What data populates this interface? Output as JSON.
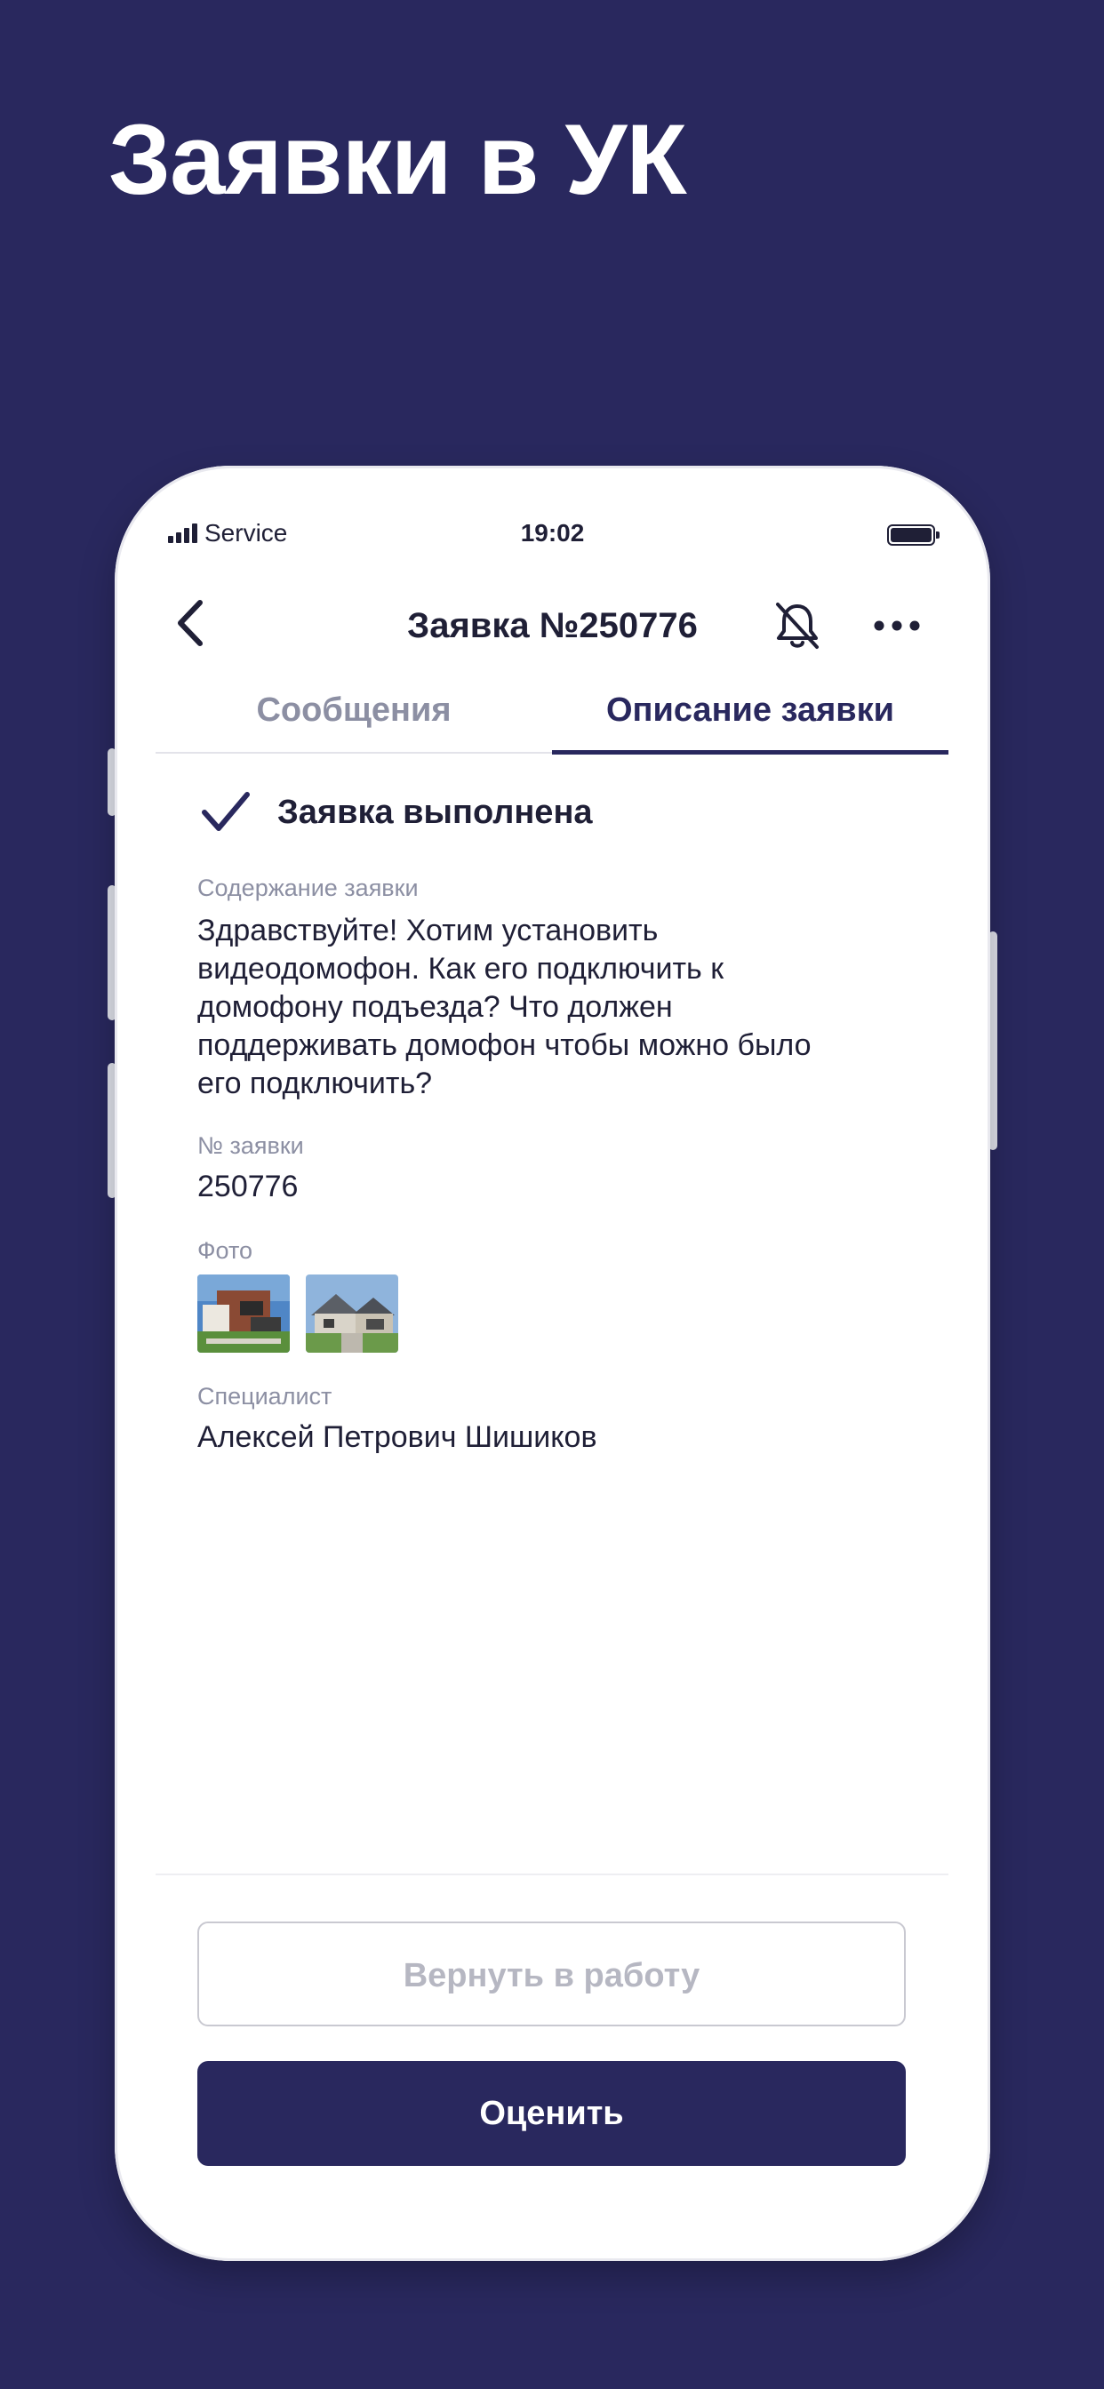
{
  "promo": {
    "headline": "Заявки в УК"
  },
  "status_bar": {
    "carrier": "Service",
    "time": "19:02"
  },
  "nav": {
    "title": "Заявка №250776",
    "back_icon": "chevron-left-icon",
    "bell_icon": "bell-off-icon",
    "more_icon": "more-horizontal-icon"
  },
  "tabs": [
    {
      "label": "Сообщения",
      "active": false
    },
    {
      "label": "Описание заявки",
      "active": true
    }
  ],
  "request": {
    "status_icon": "checkmark-icon",
    "status_text": "Заявка выполнена",
    "content_label": "Содержание заявки",
    "content_lines": [
      "Здравствуйте! Хотим установить",
      "видеодомофон. Как его подключить к",
      "домофону подъезда? Что должен",
      "поддерживать домофон чтобы можно было",
      "его подключить?"
    ],
    "number_label": "№ заявки",
    "number_value": "250776",
    "photo_label": "Фото",
    "photos": [
      "house-photo-thumbnail",
      "house-photo-thumbnail"
    ],
    "specialist_label": "Специалист",
    "specialist_value": "Алексей Петрович Шишиков"
  },
  "actions": {
    "return_label": "Вернуть в работу",
    "rate_label": "Оценить"
  },
  "colors": {
    "brand": "#29285e",
    "text": "#1f1f36",
    "muted": "#8c8fa3"
  }
}
